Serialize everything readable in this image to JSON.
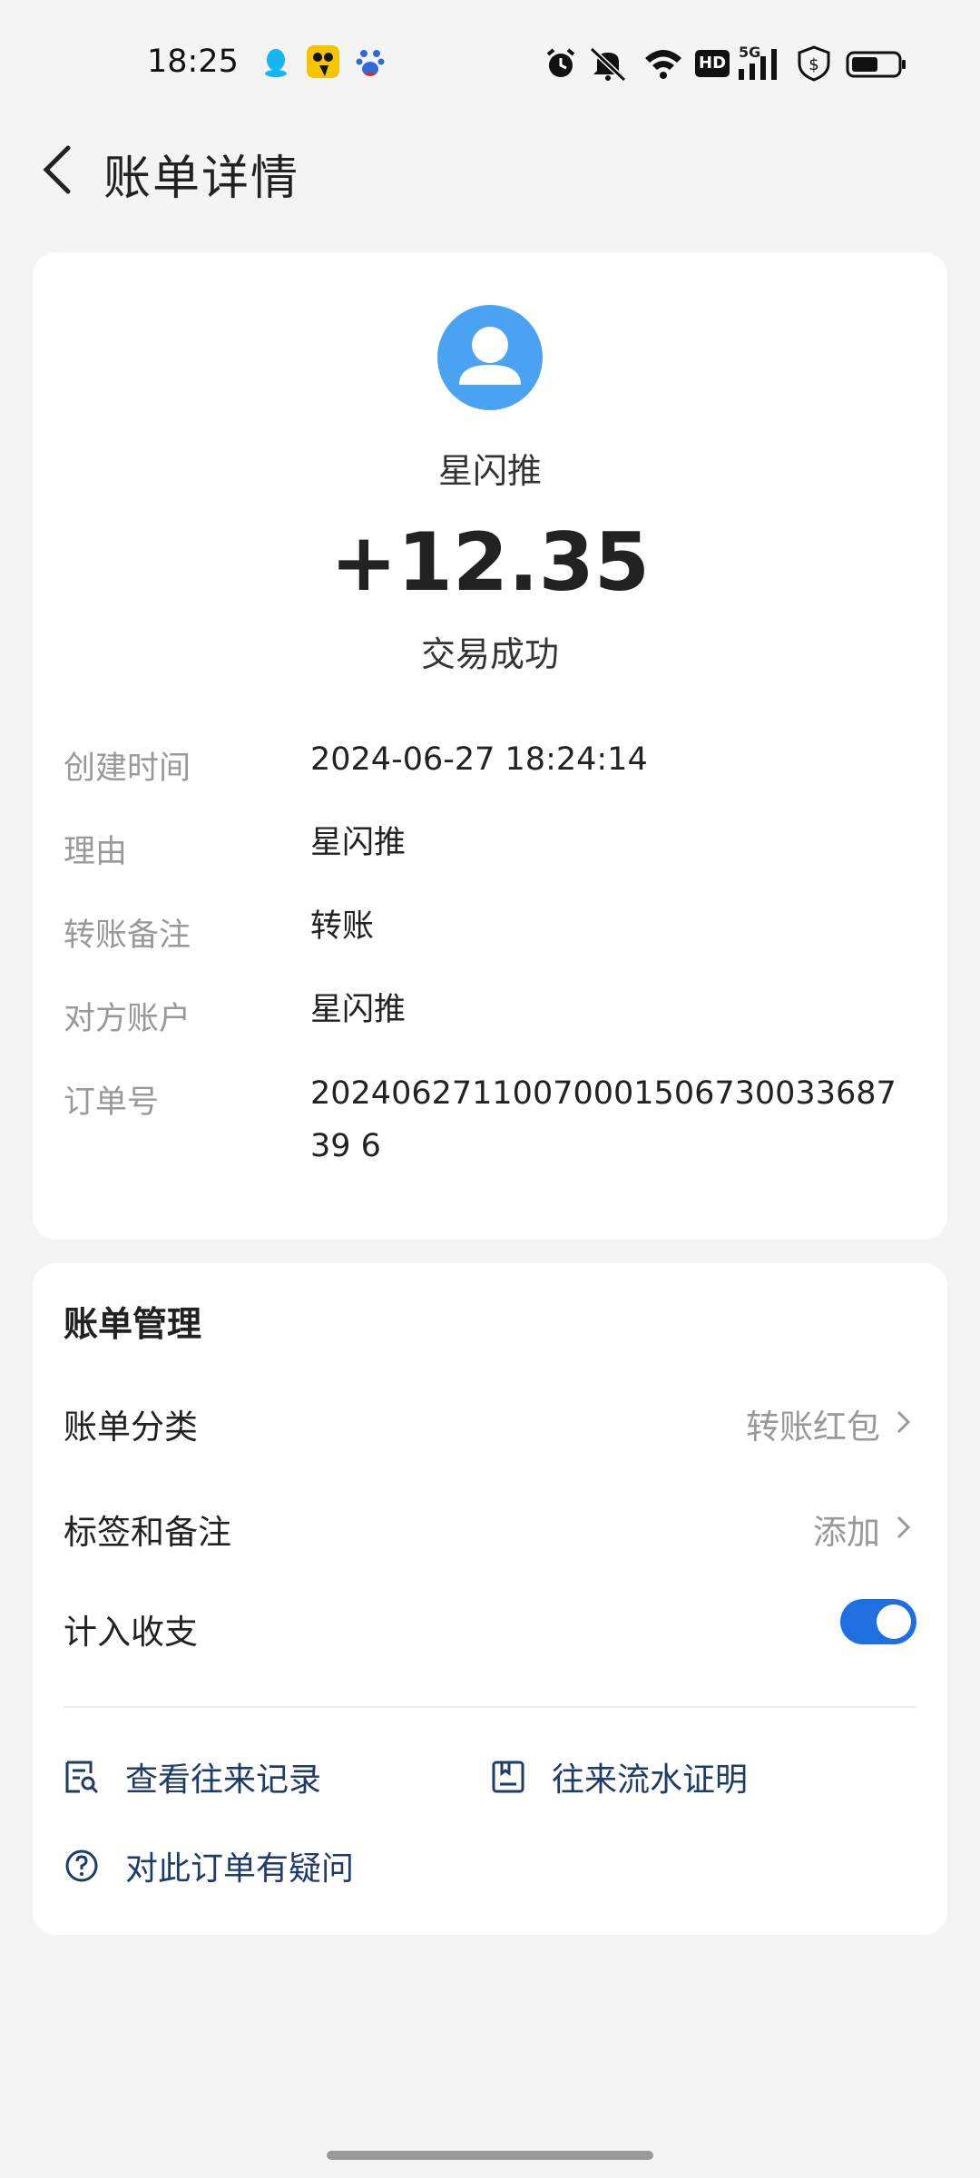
{
  "status_bar": {
    "time": "18:25",
    "notification_icons": [
      "qq-icon",
      "app-yellow-icon",
      "baidu-icon"
    ],
    "system_icons": [
      "alarm-icon",
      "mute-icon",
      "wifi-icon",
      "hd-icon",
      "signal-5g-icon",
      "shield-icon",
      "battery-icon"
    ],
    "hd_label": "HD",
    "signal_label": "5G"
  },
  "header": {
    "title": "账单详情"
  },
  "bill": {
    "name": "星闪推",
    "amount": "+12.35",
    "status": "交易成功",
    "details": [
      {
        "label": "创建时间",
        "value": "2024-06-27 18:24:14"
      },
      {
        "label": "理由",
        "value": "星闪推"
      },
      {
        "label": "转账备注",
        "value": "转账"
      },
      {
        "label": "对方账户",
        "value": "星闪推"
      },
      {
        "label": "订单号",
        "value": "2024062711007000150673003368739 6"
      }
    ]
  },
  "management": {
    "title": "账单管理",
    "category_label": "账单分类",
    "category_value": "转账红包",
    "tags_label": "标签和备注",
    "tags_value": "添加",
    "income_label": "计入收支",
    "income_toggle": true,
    "links": {
      "history": "查看往来记录",
      "statement": "往来流水证明",
      "question": "对此订单有疑问"
    }
  },
  "colors": {
    "accent": "#1f6fe0",
    "avatar": "#4aa3f2",
    "link": "#1f3b69"
  }
}
